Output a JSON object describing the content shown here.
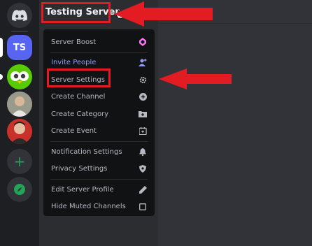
{
  "server": {
    "name": "Testing Server",
    "initials": "TS"
  },
  "menu": {
    "items": [
      {
        "label": "Server Boost",
        "icon": "boost-gem-icon"
      },
      {
        "label": "Invite People",
        "icon": "add-person-icon"
      },
      {
        "label": "Server Settings",
        "icon": "gear-icon"
      },
      {
        "label": "Create Channel",
        "icon": "plus-circle-icon"
      },
      {
        "label": "Create Category",
        "icon": "folder-plus-icon"
      },
      {
        "label": "Create Event",
        "icon": "calendar-plus-icon"
      },
      {
        "label": "Notification Settings",
        "icon": "bell-icon"
      },
      {
        "label": "Privacy Settings",
        "icon": "shield-icon"
      },
      {
        "label": "Edit Server Profile",
        "icon": "pencil-icon"
      },
      {
        "label": "Hide Muted Channels",
        "icon": "checkbox-icon"
      }
    ]
  },
  "colors": {
    "accent": "#5865f2",
    "annotation_red": "#e31b23",
    "menu_bg": "#111214"
  }
}
